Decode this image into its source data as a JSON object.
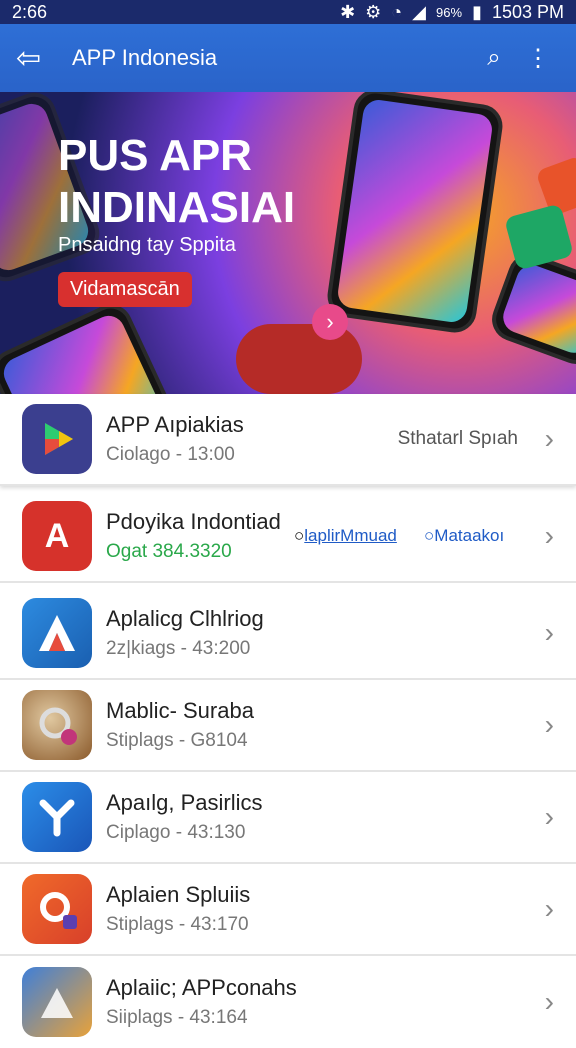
{
  "status": {
    "time": "2:66",
    "battery": "96%",
    "clock": "1503 PM"
  },
  "appbar": {
    "title": "APP Indonesia"
  },
  "banner": {
    "headline_1": "PUS APR",
    "headline_2": "INDINASIAI",
    "subtitle": "Pnsaidng tay Sppita",
    "cta": "Vidamascān"
  },
  "apps": [
    {
      "name": "APP Aıpiakias",
      "sub": "Ciolago - 13:00",
      "action": "Sthatarl Spıah"
    },
    {
      "name": "Pdoyika Indontiad",
      "sub": "Ogat 384.3320",
      "option_1": "laplirMmuad",
      "option_2": "Mataakoı"
    },
    {
      "name": "Aplalicg Clhlriog",
      "sub": "2z|kiags - 43:200"
    },
    {
      "name": "Mablic- Suraba",
      "sub": "Stiplags - G8104"
    },
    {
      "name": "Apaılg, Pasirlics",
      "sub": "Ciplago - 43:130"
    },
    {
      "name": "Aplaien Spluiis",
      "sub": "Stiplags - 43:170"
    },
    {
      "name": "Aplaiic; APPconahs",
      "sub": "Siiplags - 43:164"
    }
  ],
  "colors": {
    "appbar": "#2e6fd6",
    "statusbar": "#1b2a6b",
    "cta": "#d8302f",
    "green_text": "#2aa84a"
  }
}
